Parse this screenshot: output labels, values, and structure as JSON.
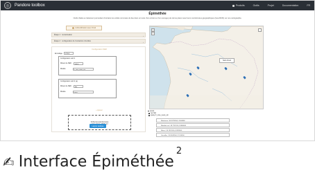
{
  "nav": {
    "brand": "Pandore toolbox",
    "links": [
      "Produits",
      "Outils",
      "Projet",
      "Documentation",
      "FR"
    ]
  },
  "page": {
    "title": "Épiméthée",
    "intro": "Outils d'aide au traitement permettant d'extraire les entités nommées de lieu dans un texte d'un extrait ou d'un ouvrage puis de les placer avec leurs coordonnées géographiques (GeoJSON) sur une cartographie."
  },
  "login_button": "Authentification avec Orcid",
  "steps": [
    {
      "label": "Étape 1 : numérisation"
    },
    {
      "label": "Étape 2 : configuration de l'extraction d'entités"
    }
  ],
  "config": {
    "title": "Configuration NER",
    "encoding_label": "Encodage",
    "encoding_value": "UTF-8",
    "blocks": [
      {
        "caption": "Configuration outil 1",
        "ner_label": "Moteur de NER",
        "ner_value": "spacy",
        "model_label": "Modèle",
        "model_value": "fr_core_news_sm"
      },
      {
        "caption": "Configuration outil 2 (a)",
        "ner_label": "Moteur de NER",
        "ner_value": "flair",
        "model_label": "Modèle",
        "model_value": "fr-ner"
      }
    ],
    "add_link": "+ Ajouter",
    "drop_text_1": "Fichier(s) sélectionné(s)",
    "drop_text_2": "saint_simon_1818.xml",
    "submit": "Lancer analyse"
  },
  "map": {
    "popup": "Saint-Cloud",
    "zoom_in": "+",
    "zoom_out": "−"
  },
  "tree": {
    "nodes": [
      "texte1",
      "ner-flair",
      "spacy-fr_core_news_sm"
    ],
    "results": [
      "Maintenon / 48.5795300,1.5506880",
      "Montfort-sur / 48.7741200,1.8066600",
      "Nérac / 44.1357000,0.3393500",
      "Versailles / 48.8049500,2.1204300"
    ]
  },
  "caption": {
    "text": "Interface Épiméthée",
    "footnote": "2"
  }
}
